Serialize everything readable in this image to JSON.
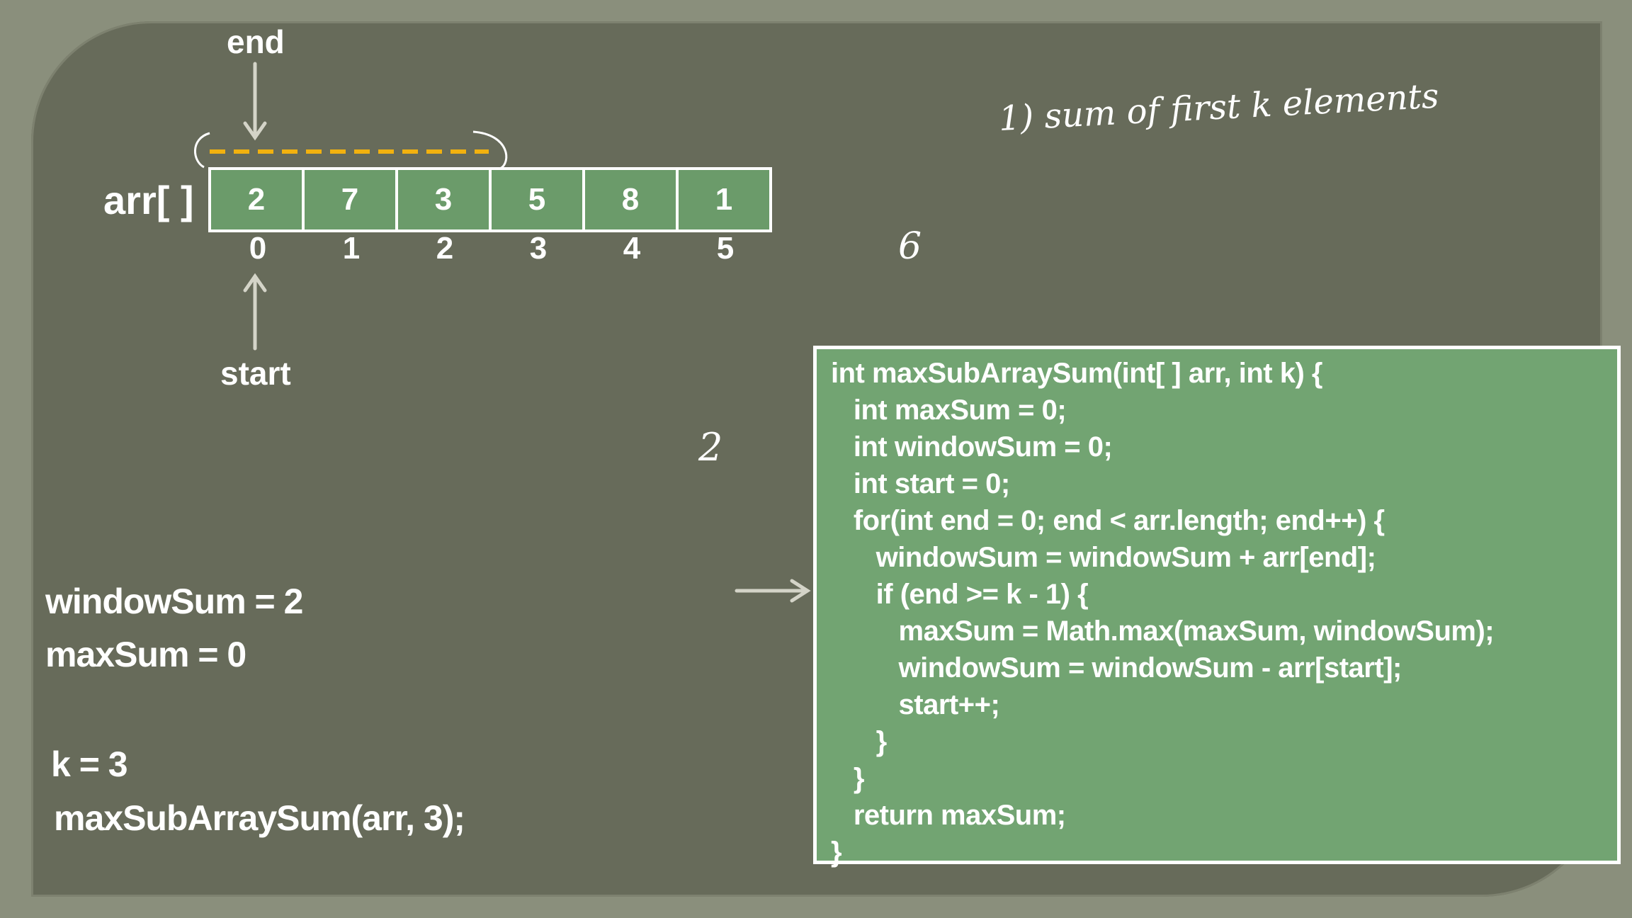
{
  "diagram": {
    "end_label": "end",
    "start_label": "start",
    "array_label": "arr[ ]",
    "array_values": [
      "2",
      "7",
      "3",
      "5",
      "8",
      "1"
    ],
    "indices": [
      "0",
      "1",
      "2",
      "3",
      "4",
      "5"
    ],
    "window_color": "#f2b10f"
  },
  "variables": {
    "window_sum": "windowSum = 2",
    "max_sum": "maxSum = 0",
    "k": "k = 3",
    "call": "maxSubArraySum(arr, 3);"
  },
  "handwriting": {
    "note": "1) sum of first  k elements",
    "six": "6",
    "two": "2"
  },
  "code": {
    "current_line": 7,
    "lines": [
      "int maxSubArraySum(int[ ] arr, int k) {",
      "   int maxSum = 0;",
      "   int windowSum = 0;",
      "   int start = 0;",
      "   for(int end = 0; end < arr.length; end++) {",
      "      windowSum = windowSum + arr[end];",
      "      if (end >= k - 1) {",
      "         maxSum = Math.max(maxSum, windowSum);",
      "         windowSum = windowSum - arr[start];",
      "         start++;",
      "      }",
      "   }",
      "   return maxSum;",
      "}"
    ]
  }
}
